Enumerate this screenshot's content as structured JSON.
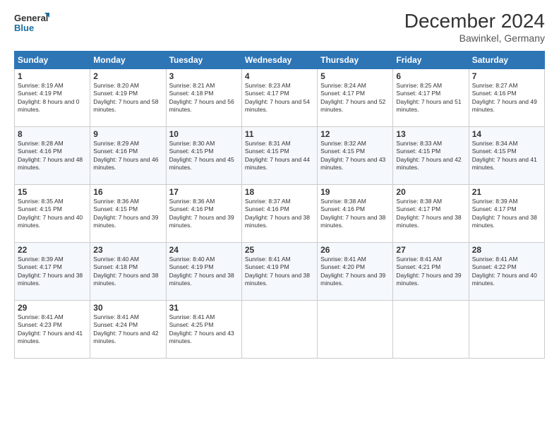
{
  "logo": {
    "line1": "General",
    "line2": "Blue"
  },
  "title": "December 2024",
  "subtitle": "Bawinkel, Germany",
  "days_of_week": [
    "Sunday",
    "Monday",
    "Tuesday",
    "Wednesday",
    "Thursday",
    "Friday",
    "Saturday"
  ],
  "weeks": [
    [
      {
        "day": "1",
        "sunrise": "Sunrise: 8:19 AM",
        "sunset": "Sunset: 4:19 PM",
        "daylight": "Daylight: 8 hours and 0 minutes."
      },
      {
        "day": "2",
        "sunrise": "Sunrise: 8:20 AM",
        "sunset": "Sunset: 4:19 PM",
        "daylight": "Daylight: 7 hours and 58 minutes."
      },
      {
        "day": "3",
        "sunrise": "Sunrise: 8:21 AM",
        "sunset": "Sunset: 4:18 PM",
        "daylight": "Daylight: 7 hours and 56 minutes."
      },
      {
        "day": "4",
        "sunrise": "Sunrise: 8:23 AM",
        "sunset": "Sunset: 4:17 PM",
        "daylight": "Daylight: 7 hours and 54 minutes."
      },
      {
        "day": "5",
        "sunrise": "Sunrise: 8:24 AM",
        "sunset": "Sunset: 4:17 PM",
        "daylight": "Daylight: 7 hours and 52 minutes."
      },
      {
        "day": "6",
        "sunrise": "Sunrise: 8:25 AM",
        "sunset": "Sunset: 4:17 PM",
        "daylight": "Daylight: 7 hours and 51 minutes."
      },
      {
        "day": "7",
        "sunrise": "Sunrise: 8:27 AM",
        "sunset": "Sunset: 4:16 PM",
        "daylight": "Daylight: 7 hours and 49 minutes."
      }
    ],
    [
      {
        "day": "8",
        "sunrise": "Sunrise: 8:28 AM",
        "sunset": "Sunset: 4:16 PM",
        "daylight": "Daylight: 7 hours and 48 minutes."
      },
      {
        "day": "9",
        "sunrise": "Sunrise: 8:29 AM",
        "sunset": "Sunset: 4:16 PM",
        "daylight": "Daylight: 7 hours and 46 minutes."
      },
      {
        "day": "10",
        "sunrise": "Sunrise: 8:30 AM",
        "sunset": "Sunset: 4:15 PM",
        "daylight": "Daylight: 7 hours and 45 minutes."
      },
      {
        "day": "11",
        "sunrise": "Sunrise: 8:31 AM",
        "sunset": "Sunset: 4:15 PM",
        "daylight": "Daylight: 7 hours and 44 minutes."
      },
      {
        "day": "12",
        "sunrise": "Sunrise: 8:32 AM",
        "sunset": "Sunset: 4:15 PM",
        "daylight": "Daylight: 7 hours and 43 minutes."
      },
      {
        "day": "13",
        "sunrise": "Sunrise: 8:33 AM",
        "sunset": "Sunset: 4:15 PM",
        "daylight": "Daylight: 7 hours and 42 minutes."
      },
      {
        "day": "14",
        "sunrise": "Sunrise: 8:34 AM",
        "sunset": "Sunset: 4:15 PM",
        "daylight": "Daylight: 7 hours and 41 minutes."
      }
    ],
    [
      {
        "day": "15",
        "sunrise": "Sunrise: 8:35 AM",
        "sunset": "Sunset: 4:15 PM",
        "daylight": "Daylight: 7 hours and 40 minutes."
      },
      {
        "day": "16",
        "sunrise": "Sunrise: 8:36 AM",
        "sunset": "Sunset: 4:15 PM",
        "daylight": "Daylight: 7 hours and 39 minutes."
      },
      {
        "day": "17",
        "sunrise": "Sunrise: 8:36 AM",
        "sunset": "Sunset: 4:16 PM",
        "daylight": "Daylight: 7 hours and 39 minutes."
      },
      {
        "day": "18",
        "sunrise": "Sunrise: 8:37 AM",
        "sunset": "Sunset: 4:16 PM",
        "daylight": "Daylight: 7 hours and 38 minutes."
      },
      {
        "day": "19",
        "sunrise": "Sunrise: 8:38 AM",
        "sunset": "Sunset: 4:16 PM",
        "daylight": "Daylight: 7 hours and 38 minutes."
      },
      {
        "day": "20",
        "sunrise": "Sunrise: 8:38 AM",
        "sunset": "Sunset: 4:17 PM",
        "daylight": "Daylight: 7 hours and 38 minutes."
      },
      {
        "day": "21",
        "sunrise": "Sunrise: 8:39 AM",
        "sunset": "Sunset: 4:17 PM",
        "daylight": "Daylight: 7 hours and 38 minutes."
      }
    ],
    [
      {
        "day": "22",
        "sunrise": "Sunrise: 8:39 AM",
        "sunset": "Sunset: 4:17 PM",
        "daylight": "Daylight: 7 hours and 38 minutes."
      },
      {
        "day": "23",
        "sunrise": "Sunrise: 8:40 AM",
        "sunset": "Sunset: 4:18 PM",
        "daylight": "Daylight: 7 hours and 38 minutes."
      },
      {
        "day": "24",
        "sunrise": "Sunrise: 8:40 AM",
        "sunset": "Sunset: 4:19 PM",
        "daylight": "Daylight: 7 hours and 38 minutes."
      },
      {
        "day": "25",
        "sunrise": "Sunrise: 8:41 AM",
        "sunset": "Sunset: 4:19 PM",
        "daylight": "Daylight: 7 hours and 38 minutes."
      },
      {
        "day": "26",
        "sunrise": "Sunrise: 8:41 AM",
        "sunset": "Sunset: 4:20 PM",
        "daylight": "Daylight: 7 hours and 39 minutes."
      },
      {
        "day": "27",
        "sunrise": "Sunrise: 8:41 AM",
        "sunset": "Sunset: 4:21 PM",
        "daylight": "Daylight: 7 hours and 39 minutes."
      },
      {
        "day": "28",
        "sunrise": "Sunrise: 8:41 AM",
        "sunset": "Sunset: 4:22 PM",
        "daylight": "Daylight: 7 hours and 40 minutes."
      }
    ],
    [
      {
        "day": "29",
        "sunrise": "Sunrise: 8:41 AM",
        "sunset": "Sunset: 4:23 PM",
        "daylight": "Daylight: 7 hours and 41 minutes."
      },
      {
        "day": "30",
        "sunrise": "Sunrise: 8:41 AM",
        "sunset": "Sunset: 4:24 PM",
        "daylight": "Daylight: 7 hours and 42 minutes."
      },
      {
        "day": "31",
        "sunrise": "Sunrise: 8:41 AM",
        "sunset": "Sunset: 4:25 PM",
        "daylight": "Daylight: 7 hours and 43 minutes."
      },
      null,
      null,
      null,
      null
    ]
  ]
}
